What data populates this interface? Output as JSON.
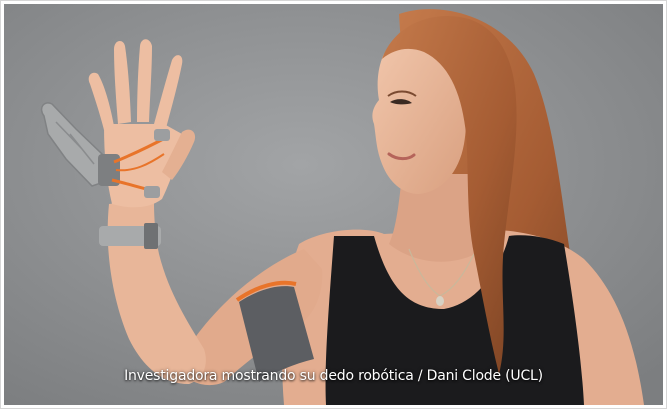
{
  "photo": {
    "caption": "Investigadora mostrando su dedo robótica / Dani Clode (UCL)",
    "subject_icon": "woman-with-robotic-thumb",
    "colors": {
      "background": "#8f9193",
      "skin": "#e9b89c",
      "hair": "#b7683c",
      "tank_top": "#1b1b1d",
      "band": "#5c5e62",
      "band_trim": "#e8742a",
      "prosthetic": "#a8aaab"
    }
  }
}
